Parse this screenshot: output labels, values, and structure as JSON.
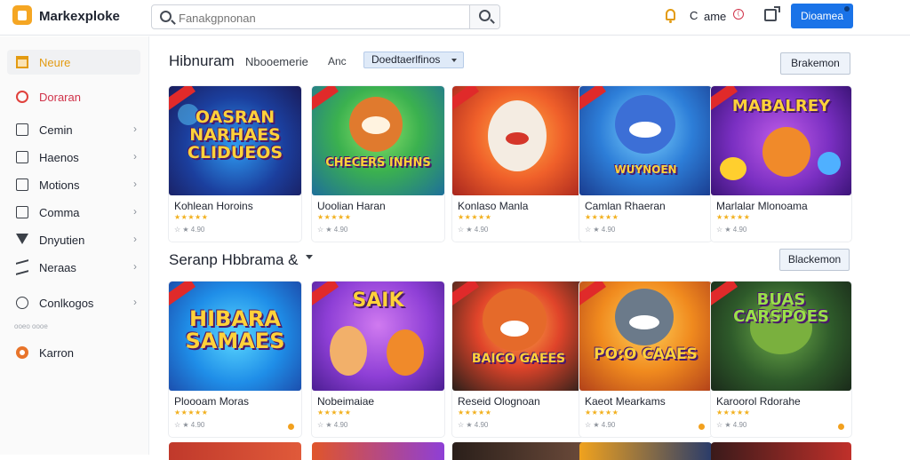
{
  "brand": "Markexploke",
  "search": {
    "placeholder": "Fanakgpnonan"
  },
  "header": {
    "user_initial": "C",
    "user_name": "ame",
    "badge": "(",
    "top_button": "Dioamea"
  },
  "colors": {
    "accent": "#1a73e8",
    "brand": "#f5a623",
    "star": "#f2b01e"
  },
  "sidebar": {
    "items": [
      {
        "label": "Neure",
        "icon": "home-icon"
      },
      {
        "label": "Doraran",
        "icon": "drop-icon"
      },
      {
        "label": "Cemin",
        "icon": "box-icon",
        "chevron": "›"
      },
      {
        "label": "Haenos",
        "icon": "box-icon",
        "chevron": "›"
      },
      {
        "label": "Motions",
        "icon": "box-icon",
        "chevron": "›"
      },
      {
        "label": "Comma",
        "icon": "box-icon",
        "chevron": "›"
      },
      {
        "label": "Dnyutien",
        "icon": "filter-icon",
        "chevron": "›"
      },
      {
        "label": "Neraas",
        "icon": "send-icon",
        "chevron": "›"
      },
      {
        "label": "Conlkogos",
        "icon": "circle-icon",
        "chevron": "›"
      },
      {
        "label": "Karron",
        "icon": "orange-icon"
      }
    ],
    "sub_label": "ooeo oooe"
  },
  "section1": {
    "title": "Hibnuram",
    "tab1": "Nbooemerie",
    "tab2": "Anc",
    "dropdown": "Doedtaerlfinos",
    "see_all": "Brakemon",
    "cards": [
      {
        "name": "Kohlean Horoins",
        "art_text": "OASRAN NARHAES CLIDUEOS",
        "sub": "☆ ★ 4.90"
      },
      {
        "name": "Uoolian Haran",
        "art_text": "CHECERS INHNS",
        "sub": "☆ ★ 4.90"
      },
      {
        "name": "Konlaso Manla",
        "art_text": "",
        "sub": "☆ ★ 4.90"
      },
      {
        "name": "Camlan Rhaeran",
        "art_text": "WUYNOEN",
        "sub": "☆ ★ 4.90"
      },
      {
        "name": "Marlalar Mlonoama",
        "art_text": "MABALREY",
        "sub": "☆ ★ 4.90"
      }
    ]
  },
  "section2": {
    "title": "Seranp Hbbrama &",
    "see_all": "Blackemon",
    "cards": [
      {
        "name": "Ploooam Moras",
        "art_text": "HIBARA SAMAES",
        "sub": "☆ ★ 4.90"
      },
      {
        "name": "Nobeimaiae",
        "art_text": "SAIK",
        "sub": "☆ ★ 4.90"
      },
      {
        "name": "Reseid Olognoan",
        "art_text": "BAICO GAEES",
        "sub": "☆ ★ 4.90"
      },
      {
        "name": "Kaeot Mearkams",
        "art_text": "PO:O CAAES",
        "sub": "☆ ★ 4.90"
      },
      {
        "name": "Karoorol Rdorahe",
        "art_text": "BUAS CARSPOES",
        "sub": "☆ ★ 4.90"
      }
    ]
  },
  "stars": "★★★★★"
}
